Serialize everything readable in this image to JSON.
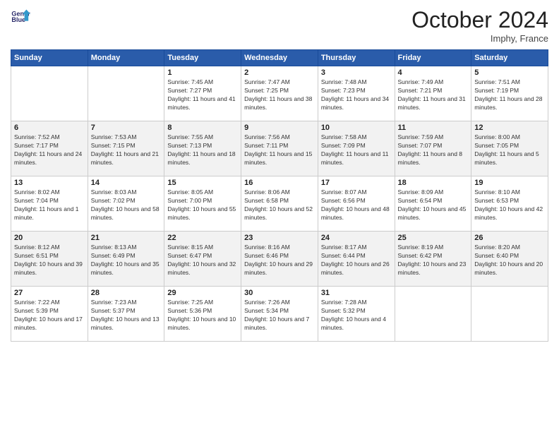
{
  "header": {
    "logo_line1": "General",
    "logo_line2": "Blue",
    "month": "October 2024",
    "location": "Imphy, France"
  },
  "weekdays": [
    "Sunday",
    "Monday",
    "Tuesday",
    "Wednesday",
    "Thursday",
    "Friday",
    "Saturday"
  ],
  "weeks": [
    [
      {
        "day": "",
        "sunrise": "",
        "sunset": "",
        "daylight": ""
      },
      {
        "day": "",
        "sunrise": "",
        "sunset": "",
        "daylight": ""
      },
      {
        "day": "1",
        "sunrise": "Sunrise: 7:45 AM",
        "sunset": "Sunset: 7:27 PM",
        "daylight": "Daylight: 11 hours and 41 minutes."
      },
      {
        "day": "2",
        "sunrise": "Sunrise: 7:47 AM",
        "sunset": "Sunset: 7:25 PM",
        "daylight": "Daylight: 11 hours and 38 minutes."
      },
      {
        "day": "3",
        "sunrise": "Sunrise: 7:48 AM",
        "sunset": "Sunset: 7:23 PM",
        "daylight": "Daylight: 11 hours and 34 minutes."
      },
      {
        "day": "4",
        "sunrise": "Sunrise: 7:49 AM",
        "sunset": "Sunset: 7:21 PM",
        "daylight": "Daylight: 11 hours and 31 minutes."
      },
      {
        "day": "5",
        "sunrise": "Sunrise: 7:51 AM",
        "sunset": "Sunset: 7:19 PM",
        "daylight": "Daylight: 11 hours and 28 minutes."
      }
    ],
    [
      {
        "day": "6",
        "sunrise": "Sunrise: 7:52 AM",
        "sunset": "Sunset: 7:17 PM",
        "daylight": "Daylight: 11 hours and 24 minutes."
      },
      {
        "day": "7",
        "sunrise": "Sunrise: 7:53 AM",
        "sunset": "Sunset: 7:15 PM",
        "daylight": "Daylight: 11 hours and 21 minutes."
      },
      {
        "day": "8",
        "sunrise": "Sunrise: 7:55 AM",
        "sunset": "Sunset: 7:13 PM",
        "daylight": "Daylight: 11 hours and 18 minutes."
      },
      {
        "day": "9",
        "sunrise": "Sunrise: 7:56 AM",
        "sunset": "Sunset: 7:11 PM",
        "daylight": "Daylight: 11 hours and 15 minutes."
      },
      {
        "day": "10",
        "sunrise": "Sunrise: 7:58 AM",
        "sunset": "Sunset: 7:09 PM",
        "daylight": "Daylight: 11 hours and 11 minutes."
      },
      {
        "day": "11",
        "sunrise": "Sunrise: 7:59 AM",
        "sunset": "Sunset: 7:07 PM",
        "daylight": "Daylight: 11 hours and 8 minutes."
      },
      {
        "day": "12",
        "sunrise": "Sunrise: 8:00 AM",
        "sunset": "Sunset: 7:05 PM",
        "daylight": "Daylight: 11 hours and 5 minutes."
      }
    ],
    [
      {
        "day": "13",
        "sunrise": "Sunrise: 8:02 AM",
        "sunset": "Sunset: 7:04 PM",
        "daylight": "Daylight: 11 hours and 1 minute."
      },
      {
        "day": "14",
        "sunrise": "Sunrise: 8:03 AM",
        "sunset": "Sunset: 7:02 PM",
        "daylight": "Daylight: 10 hours and 58 minutes."
      },
      {
        "day": "15",
        "sunrise": "Sunrise: 8:05 AM",
        "sunset": "Sunset: 7:00 PM",
        "daylight": "Daylight: 10 hours and 55 minutes."
      },
      {
        "day": "16",
        "sunrise": "Sunrise: 8:06 AM",
        "sunset": "Sunset: 6:58 PM",
        "daylight": "Daylight: 10 hours and 52 minutes."
      },
      {
        "day": "17",
        "sunrise": "Sunrise: 8:07 AM",
        "sunset": "Sunset: 6:56 PM",
        "daylight": "Daylight: 10 hours and 48 minutes."
      },
      {
        "day": "18",
        "sunrise": "Sunrise: 8:09 AM",
        "sunset": "Sunset: 6:54 PM",
        "daylight": "Daylight: 10 hours and 45 minutes."
      },
      {
        "day": "19",
        "sunrise": "Sunrise: 8:10 AM",
        "sunset": "Sunset: 6:53 PM",
        "daylight": "Daylight: 10 hours and 42 minutes."
      }
    ],
    [
      {
        "day": "20",
        "sunrise": "Sunrise: 8:12 AM",
        "sunset": "Sunset: 6:51 PM",
        "daylight": "Daylight: 10 hours and 39 minutes."
      },
      {
        "day": "21",
        "sunrise": "Sunrise: 8:13 AM",
        "sunset": "Sunset: 6:49 PM",
        "daylight": "Daylight: 10 hours and 35 minutes."
      },
      {
        "day": "22",
        "sunrise": "Sunrise: 8:15 AM",
        "sunset": "Sunset: 6:47 PM",
        "daylight": "Daylight: 10 hours and 32 minutes."
      },
      {
        "day": "23",
        "sunrise": "Sunrise: 8:16 AM",
        "sunset": "Sunset: 6:46 PM",
        "daylight": "Daylight: 10 hours and 29 minutes."
      },
      {
        "day": "24",
        "sunrise": "Sunrise: 8:17 AM",
        "sunset": "Sunset: 6:44 PM",
        "daylight": "Daylight: 10 hours and 26 minutes."
      },
      {
        "day": "25",
        "sunrise": "Sunrise: 8:19 AM",
        "sunset": "Sunset: 6:42 PM",
        "daylight": "Daylight: 10 hours and 23 minutes."
      },
      {
        "day": "26",
        "sunrise": "Sunrise: 8:20 AM",
        "sunset": "Sunset: 6:40 PM",
        "daylight": "Daylight: 10 hours and 20 minutes."
      }
    ],
    [
      {
        "day": "27",
        "sunrise": "Sunrise: 7:22 AM",
        "sunset": "Sunset: 5:39 PM",
        "daylight": "Daylight: 10 hours and 17 minutes."
      },
      {
        "day": "28",
        "sunrise": "Sunrise: 7:23 AM",
        "sunset": "Sunset: 5:37 PM",
        "daylight": "Daylight: 10 hours and 13 minutes."
      },
      {
        "day": "29",
        "sunrise": "Sunrise: 7:25 AM",
        "sunset": "Sunset: 5:36 PM",
        "daylight": "Daylight: 10 hours and 10 minutes."
      },
      {
        "day": "30",
        "sunrise": "Sunrise: 7:26 AM",
        "sunset": "Sunset: 5:34 PM",
        "daylight": "Daylight: 10 hours and 7 minutes."
      },
      {
        "day": "31",
        "sunrise": "Sunrise: 7:28 AM",
        "sunset": "Sunset: 5:32 PM",
        "daylight": "Daylight: 10 hours and 4 minutes."
      },
      {
        "day": "",
        "sunrise": "",
        "sunset": "",
        "daylight": ""
      },
      {
        "day": "",
        "sunrise": "",
        "sunset": "",
        "daylight": ""
      }
    ]
  ]
}
